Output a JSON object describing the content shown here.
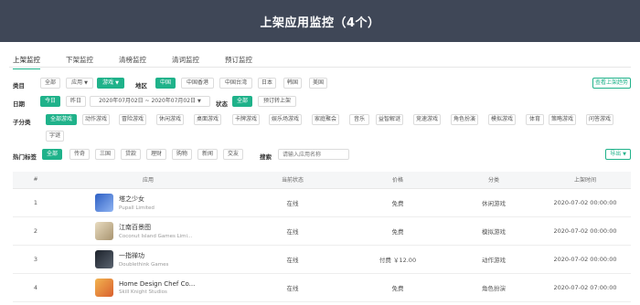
{
  "header": {
    "title": "上架应用监控（4个）"
  },
  "tabs": [
    {
      "label": "上架监控"
    },
    {
      "label": "下架监控"
    },
    {
      "label": "清榜监控"
    },
    {
      "label": "清词监控"
    },
    {
      "label": "预订监控"
    }
  ],
  "filters": {
    "category": {
      "label": "类目",
      "options": [
        "全部",
        "应用",
        "游戏"
      ],
      "region_label": "地区",
      "regions": [
        "中国",
        "中国香港",
        "中国台湾",
        "日本",
        "韩国",
        "美国"
      ]
    },
    "view_removed_label": "查看上架趋势",
    "date": {
      "label": "日期",
      "today": "今日",
      "yesterday": "昨日",
      "range": "2020年07月02日 ~ 2020年07月02日",
      "status_label": "状态",
      "status_options": [
        "全部",
        "预订转上架"
      ]
    },
    "subcategory": {
      "label": "子分类",
      "options": [
        "全部游戏",
        "动作游戏",
        "冒险游戏",
        "休闲游戏",
        "桌面游戏",
        "卡牌游戏",
        "娱乐场游戏",
        "家庭聚会",
        "音乐",
        "益智解谜",
        "竞速游戏",
        "角色扮演",
        "模拟游戏",
        "体育",
        "策略游戏",
        "问答游戏",
        "字谜"
      ]
    },
    "tags": {
      "label": "热门标签",
      "options": [
        "全部",
        "传奇",
        "三国",
        "贷款",
        "理财",
        "购物",
        "新闻",
        "交友"
      ],
      "search_label": "搜索",
      "search_placeholder": "请输入应用名称"
    },
    "export_label": "导出"
  },
  "table": {
    "headers": [
      "#",
      "应用",
      "当前状态",
      "价格",
      "分类",
      "上架时间"
    ],
    "rows": [
      {
        "index": "1",
        "name": "塔之少女",
        "developer": "Pupall Limited",
        "status": "在线",
        "price": "免费",
        "category": "休闲游戏",
        "time": "2020-07-02 00:00:00",
        "icon": "anime-girl-icon",
        "icon_color": "#3b6fd8"
      },
      {
        "index": "2",
        "name": "江南百景图",
        "developer": "Coconut Island Games Limi...",
        "status": "在线",
        "price": "免费",
        "category": "模拟游戏",
        "time": "2020-07-02 00:00:00",
        "icon": "scholar-icon",
        "icon_color": "#d8c9a8"
      },
      {
        "index": "3",
        "name": "一指禅功",
        "developer": "Doublethink Games",
        "status": "在线",
        "price": "付费 ￥12.00",
        "category": "动作游戏",
        "time": "2020-07-02 00:00:00",
        "icon": "kungfu-icon",
        "icon_color": "#222933"
      },
      {
        "index": "4",
        "name": "Home Design Chef Co...",
        "developer": "Skill Knight Studios",
        "status": "在线",
        "price": "免费",
        "category": "角色扮演",
        "time": "2020-07-02 07:00:00",
        "icon": "chef-icon",
        "icon_color": "#e8a040"
      }
    ]
  },
  "colors": {
    "header_bg": "#3f4757",
    "accent": "#1fb28a"
  }
}
